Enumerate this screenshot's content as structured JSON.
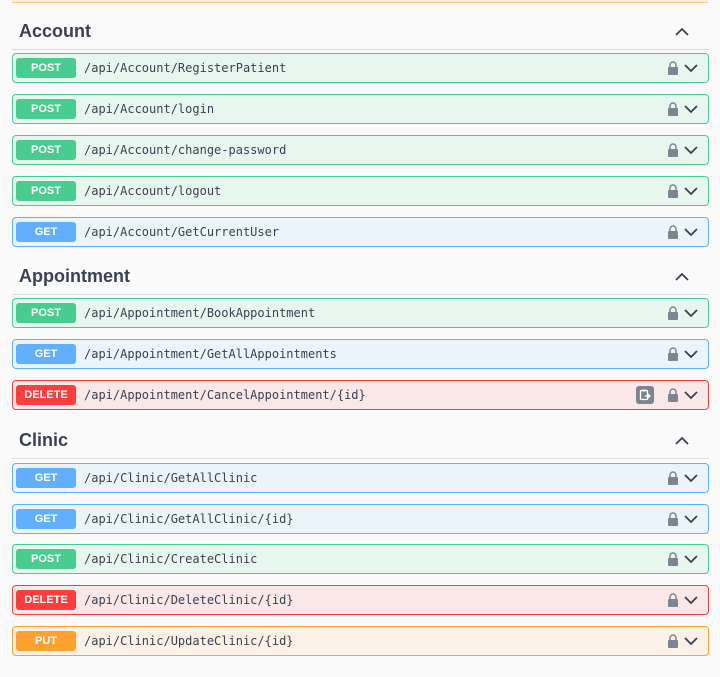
{
  "sections": [
    {
      "title": "Account",
      "operations": [
        {
          "method": "POST",
          "path": "/api/Account/RegisterPatient"
        },
        {
          "method": "POST",
          "path": "/api/Account/login"
        },
        {
          "method": "POST",
          "path": "/api/Account/change-password"
        },
        {
          "method": "POST",
          "path": "/api/Account/logout"
        },
        {
          "method": "GET",
          "path": "/api/Account/GetCurrentUser"
        }
      ]
    },
    {
      "title": "Appointment",
      "operations": [
        {
          "method": "POST",
          "path": "/api/Appointment/BookAppointment"
        },
        {
          "method": "GET",
          "path": "/api/Appointment/GetAllAppointments"
        },
        {
          "method": "DELETE",
          "path": "/api/Appointment/CancelAppointment/{id}"
        }
      ]
    },
    {
      "title": "Clinic",
      "operations": [
        {
          "method": "GET",
          "path": "/api/Clinic/GetAllClinic"
        },
        {
          "method": "GET",
          "path": "/api/Clinic/GetAllClinic/{id}"
        },
        {
          "method": "POST",
          "path": "/api/Clinic/CreateClinic"
        },
        {
          "method": "DELETE",
          "path": "/api/Clinic/DeleteClinic/{id}"
        },
        {
          "method": "PUT",
          "path": "/api/Clinic/UpdateClinic/{id}"
        }
      ]
    }
  ],
  "icons": {
    "lock": "lock-icon",
    "chevron": "chevron-down-icon",
    "collapse": "chevron-up-icon",
    "copy": "copy-to-clipboard-icon"
  },
  "colors": {
    "post": "#49cc90",
    "get": "#61affe",
    "delete": "#f93e3e",
    "put": "#fca130"
  }
}
